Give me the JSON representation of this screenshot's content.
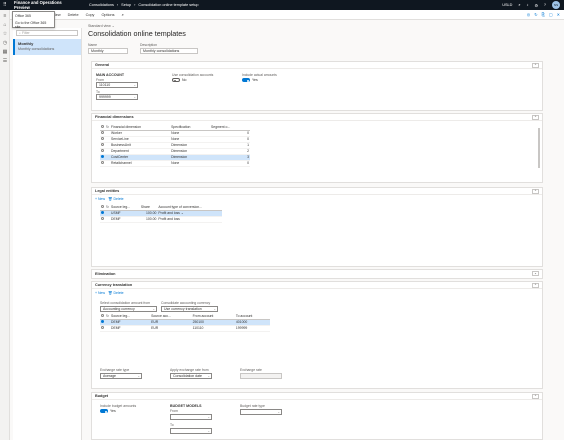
{
  "topbar": {
    "app": "Finance and Operations Preview",
    "crumbs": [
      "Consolidations",
      "Setup",
      "Consolidation online template setup"
    ],
    "company": "USLD",
    "user": "NS"
  },
  "actionbar": {
    "items": [
      "Save",
      "New",
      "Delete",
      "Copy",
      "Options"
    ],
    "search_icon": "search-icon"
  },
  "tooltip": {
    "line1": "Office 365",
    "line2": "Go to the Office 365 site"
  },
  "listpane": {
    "filter_placeholder": "Filter",
    "item_title": "Monthly",
    "item_subtitle": "Monthly consolidations"
  },
  "header": {
    "view": "Standard view",
    "title": "Consolidation online templates",
    "name_label": "Name",
    "name_value": "Monthly",
    "desc_label": "Description",
    "desc_value": "Monthly consolidations"
  },
  "general": {
    "title": "General",
    "main_account": "MAIN ACCOUNT",
    "from_label": "From",
    "from_value": "110110",
    "to_label": "To",
    "to_value": "999999",
    "use_accts_label": "Use consolidation accounts",
    "use_accts_value": "No",
    "include_actual_label": "Include actual amounts",
    "include_actual_value": "Yes"
  },
  "fin_dims": {
    "title": "Financial dimensions",
    "columns": [
      "Financial dimension",
      "Specification",
      "Segment o..."
    ],
    "rows": [
      {
        "dim": "Worker",
        "spec": "None",
        "seg": "0"
      },
      {
        "dim": "ServiceLine",
        "spec": "None",
        "seg": "0"
      },
      {
        "dim": "BusinessUnit",
        "spec": "Dimension",
        "seg": "1"
      },
      {
        "dim": "Department",
        "spec": "Dimension",
        "seg": "2"
      },
      {
        "dim": "CostCenter",
        "spec": "Dimension",
        "seg": "3"
      },
      {
        "dim": "Retailchannel",
        "spec": "None",
        "seg": "0"
      }
    ]
  },
  "legal_entities": {
    "title": "Legal entities",
    "new": "New",
    "delete": "Delete",
    "columns": [
      "Source leg...",
      "Share",
      "Account type of conversion..."
    ],
    "rows": [
      {
        "entity": "USMF",
        "share": "100.00",
        "type": "Profit and loss"
      },
      {
        "entity": "DEMF",
        "share": "100.00",
        "type": "Profit and loss"
      }
    ]
  },
  "elimination": {
    "title": "Elimination"
  },
  "currency": {
    "title": "Currency translation",
    "new": "New",
    "delete": "Delete",
    "select_label": "Select consolidation amount from",
    "select_value": "Accounting currency",
    "cons_label": "Consolidate accounting currency",
    "cons_value": "Use currency translation",
    "columns": [
      "Source leg...",
      "Source acc...",
      "From account",
      "To account"
    ],
    "rows": [
      {
        "entity": "DEMF",
        "cur": "EUR",
        "from": "250100",
        "to": "401000"
      },
      {
        "entity": "DEMF",
        "cur": "EUR",
        "from": "110110",
        "to": "199999"
      }
    ],
    "rate_type_label": "Exchange rate type",
    "rate_type_value": "Average",
    "apply_label": "Apply exchange rate from",
    "apply_value": "Consolidation date",
    "rate_label": "Exchange rate",
    "rate_value": ""
  },
  "budget": {
    "title": "Budget",
    "include_label": "Include budget amounts",
    "include_value": "Yes",
    "models": "BUDGET MODELS",
    "from_label": "From",
    "to_label": "To",
    "type_label": "Budget rate type"
  }
}
